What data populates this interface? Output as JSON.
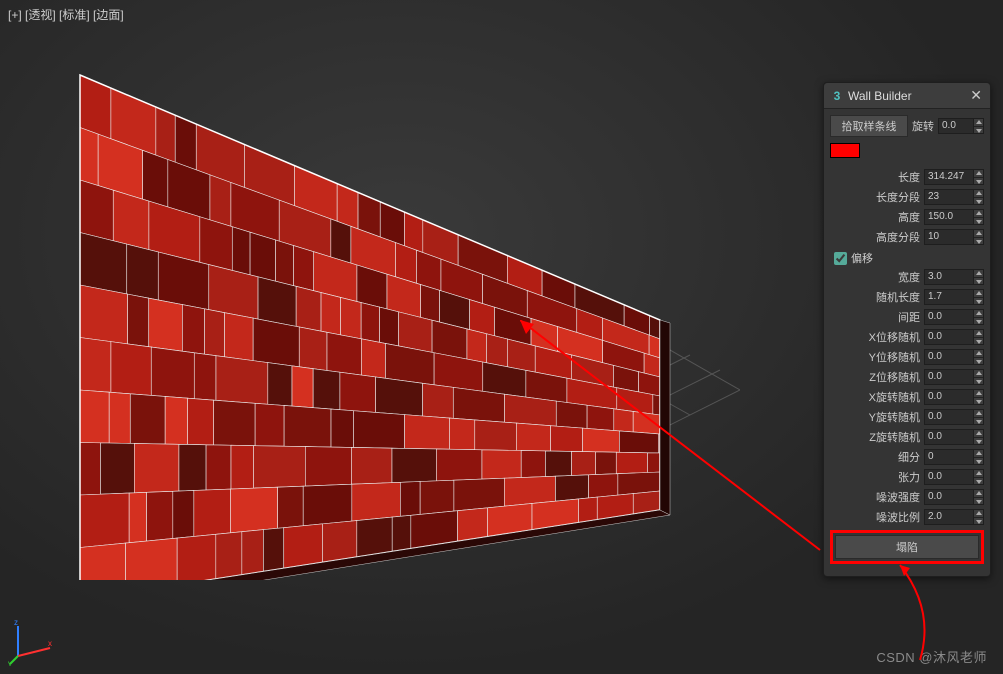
{
  "viewport_label": "[+] [透视] [标准] [边面]",
  "panel": {
    "icon": "3",
    "title": "Wall Builder",
    "pick_spline": "拾取样条线",
    "rotate_label": "旋转",
    "rotate_value": "0.0",
    "color": "#ff0000",
    "offset_check": "偏移",
    "collapse": "塌陷",
    "params": [
      {
        "label": "长度",
        "value": "314.247"
      },
      {
        "label": "长度分段",
        "value": "23"
      },
      {
        "label": "高度",
        "value": "150.0"
      },
      {
        "label": "高度分段",
        "value": "10"
      }
    ],
    "offset_params": [
      {
        "label": "宽度",
        "value": "3.0"
      },
      {
        "label": "随机长度",
        "value": "1.7"
      },
      {
        "label": "间距",
        "value": "0.0"
      },
      {
        "label": "X位移随机",
        "value": "0.0"
      },
      {
        "label": "Y位移随机",
        "value": "0.0"
      },
      {
        "label": "Z位移随机",
        "value": "0.0"
      },
      {
        "label": "X旋转随机",
        "value": "0.0"
      },
      {
        "label": "Y旋转随机",
        "value": "0.0"
      },
      {
        "label": "Z旋转随机",
        "value": "0.0"
      },
      {
        "label": "细分",
        "value": "0"
      },
      {
        "label": "张力",
        "value": "0.0"
      },
      {
        "label": "噪波强度",
        "value": "0.0"
      },
      {
        "label": "噪波比例",
        "value": "2.0"
      }
    ]
  },
  "watermark": "CSDN @沐风老师"
}
